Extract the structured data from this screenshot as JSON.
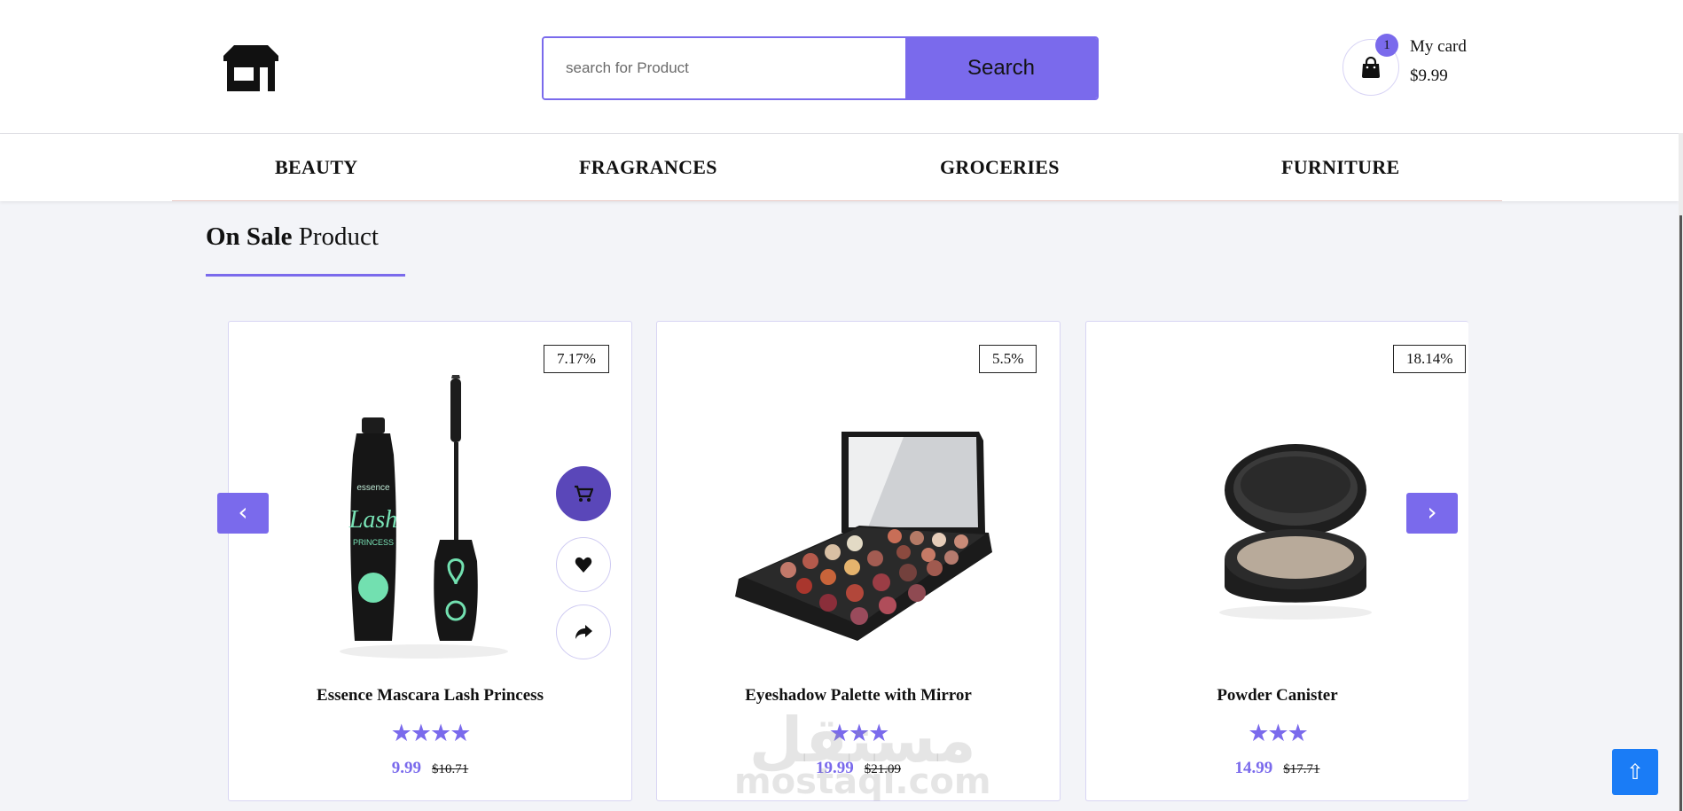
{
  "header": {
    "logo_icon": "storefront-icon",
    "search": {
      "placeholder": "search for Product",
      "value": "",
      "button_label": "Search",
      "accent": "#7a6aec"
    },
    "cart": {
      "badge": "1",
      "label": "My card",
      "total": "$9.99",
      "icon": "shopping-bag-icon"
    }
  },
  "nav": {
    "items": [
      {
        "label": "BEAUTY"
      },
      {
        "label": "FRAGRANCES"
      },
      {
        "label": "GROCERIES"
      },
      {
        "label": "FURNITURE"
      }
    ]
  },
  "section": {
    "title_bold": "On Sale",
    "title_rest": "Product"
  },
  "products": [
    {
      "name": "Essence Mascara Lash Princess",
      "discount": "7.17%",
      "stars": "★★★★",
      "price": "9.99",
      "old_price": "$10.71",
      "image": "mascara"
    },
    {
      "name": "Eyeshadow Palette with Mirror",
      "discount": "5.5%",
      "stars": "★★★",
      "price": "19.99",
      "old_price": "$21.09",
      "image": "eyeshadow-palette"
    },
    {
      "name": "Powder Canister",
      "discount": "18.14%",
      "stars": "★★★",
      "price": "14.99",
      "old_price": "$17.71",
      "image": "powder-compact"
    }
  ],
  "carousel": {
    "prev_label": "‹",
    "next_label": "›"
  },
  "watermark": {
    "arabic": "مستقل",
    "latin": "mostaql.com"
  },
  "back_to_top": {
    "label": "⇧"
  }
}
